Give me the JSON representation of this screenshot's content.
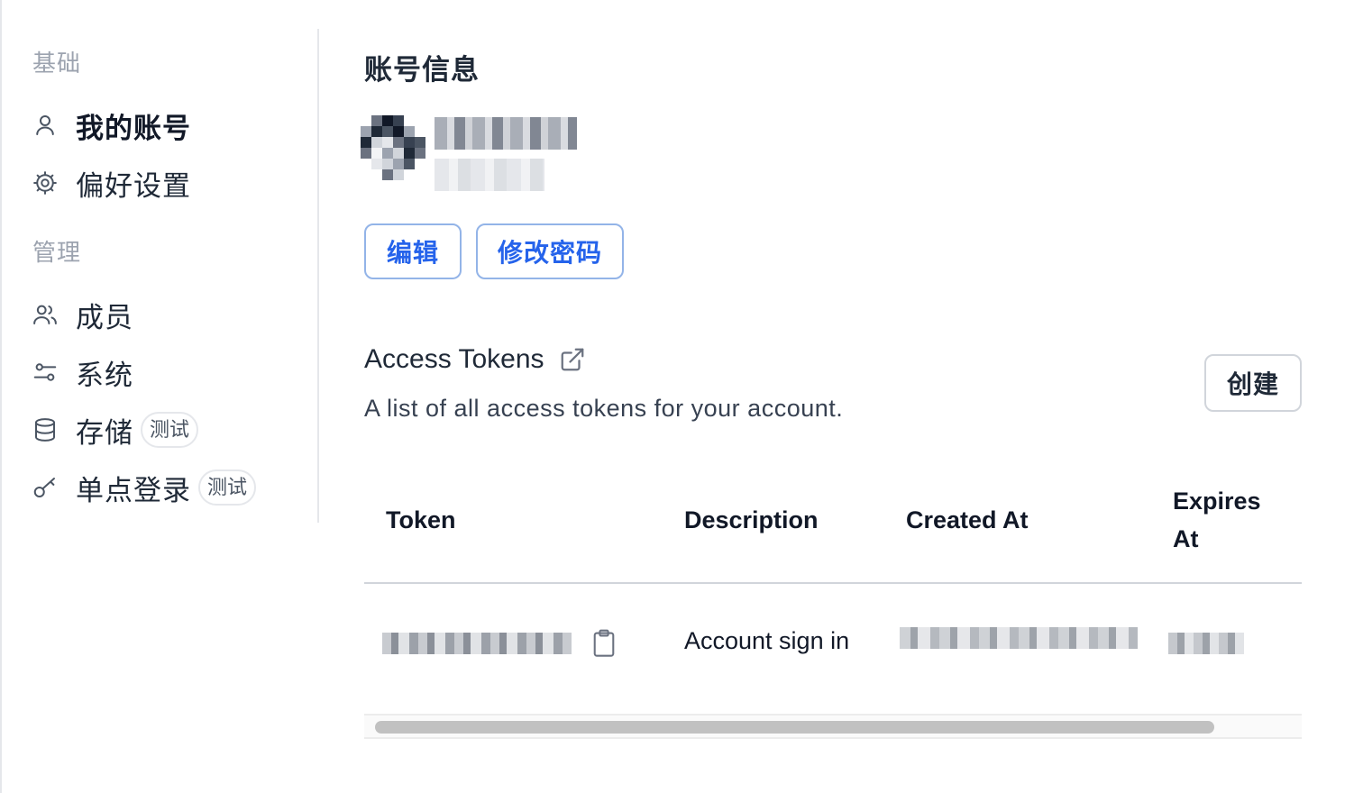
{
  "sidebar": {
    "section_basic": "基础",
    "section_manage": "管理",
    "items": [
      {
        "label": "我的账号",
        "icon": "user-icon",
        "active": true
      },
      {
        "label": "偏好设置",
        "icon": "gear-icon"
      },
      {
        "label": "成员",
        "icon": "users-icon"
      },
      {
        "label": "系统",
        "icon": "sliders-icon"
      },
      {
        "label": "存储",
        "icon": "database-icon",
        "badge": "测试"
      },
      {
        "label": "单点登录",
        "icon": "key-icon",
        "badge": "测试"
      }
    ]
  },
  "account": {
    "title": "账号信息",
    "edit_button": "编辑",
    "change_password_button": "修改密码"
  },
  "tokens": {
    "title": "Access Tokens",
    "description": "A list of all access tokens for your account.",
    "create_button": "创建",
    "columns": [
      "Token",
      "Description",
      "Created At",
      "Expires At"
    ],
    "rows": [
      {
        "description": "Account sign in"
      }
    ]
  },
  "colors": {
    "accent": "#2563eb",
    "border": "#e5e7eb",
    "muted_text": "#9ca3af"
  }
}
